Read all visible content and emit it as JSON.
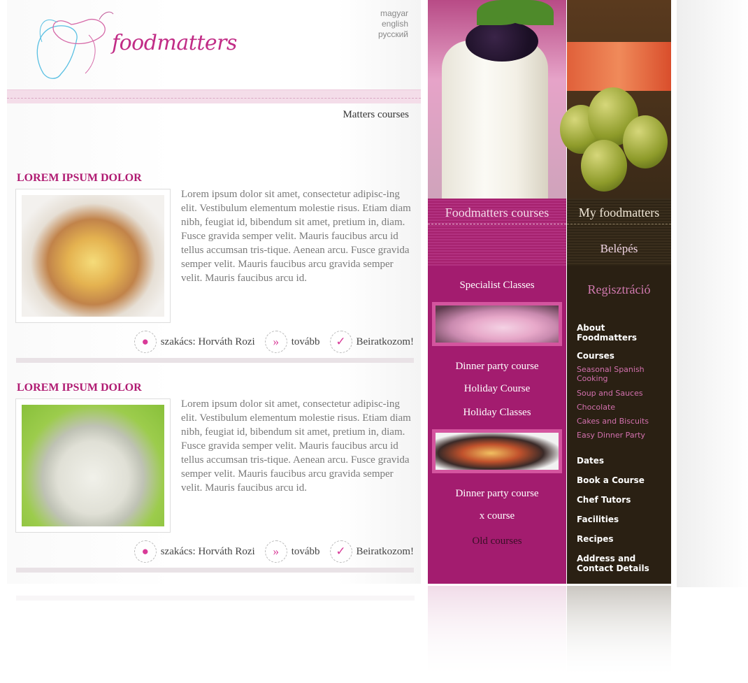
{
  "brand": {
    "name": "foodmatters",
    "accent": "#c12c86"
  },
  "languages": [
    "magyar",
    "english",
    "русский"
  ],
  "section_title": "Matters courses",
  "articles": [
    {
      "title": "LOREM IPSUM DOLOR",
      "text": "Lorem ipsum dolor sit amet, consectetur adipisc-ing elit. Vestibulum elementum molestie risus. Etiam diam nibh, feugiat id, bibendum sit amet, pretium in, diam. Fusce gravida semper velit. Mauris faucibus arcu id tellus accumsan tris-tique. Aenean arcu. Fusce gravida semper velit. Mauris faucibus arcu gravida semper velit. Mauris faucibus arcu id.",
      "chef": "szakács: Horváth Rozi",
      "more": "tovább",
      "enroll": "Beiratkozom!"
    },
    {
      "title": "LOREM IPSUM DOLOR",
      "text": "Lorem ipsum dolor sit amet, consectetur adipisc-ing elit. Vestibulum elementum molestie risus. Etiam diam nibh, feugiat id, bibendum sit amet, pretium in, diam. Fusce gravida semper velit. Mauris faucibus arcu id tellus accumsan tris-tique. Aenean arcu. Fusce gravida semper velit. Mauris faucibus arcu gravida semper velit. Mauris faucibus arcu id.",
      "chef": "szakács: Horváth Rozi",
      "more": "tovább",
      "enroll": "Beiratkozom!"
    }
  ],
  "courses_column": {
    "tab": "Foodmatters courses",
    "links": [
      "Specialist Classes",
      "Dinner party course",
      "Holiday Course",
      "Holiday Classes",
      "Dinner party course",
      "x course",
      "Old courses"
    ]
  },
  "account_column": {
    "tab": "My foodmatters",
    "login": "Belépés",
    "register": "Regisztráció",
    "nav": {
      "about": "About Foodmatters",
      "courses": "Courses",
      "subcourses": [
        "Seasonal Spanish Cooking",
        "Soup and Sauces",
        "Chocolate",
        "Cakes and Biscuits",
        "Easy Dinner Party"
      ],
      "dates": "Dates",
      "book": "Book a Course",
      "tutors": "Chef Tutors",
      "facilities": "Facilities",
      "recipes": "Recipes",
      "contact": "Address and Contact Details"
    }
  },
  "colors": {
    "pink": "#a31c6f",
    "dark": "#2a2013",
    "link_pink": "#d270ad"
  }
}
